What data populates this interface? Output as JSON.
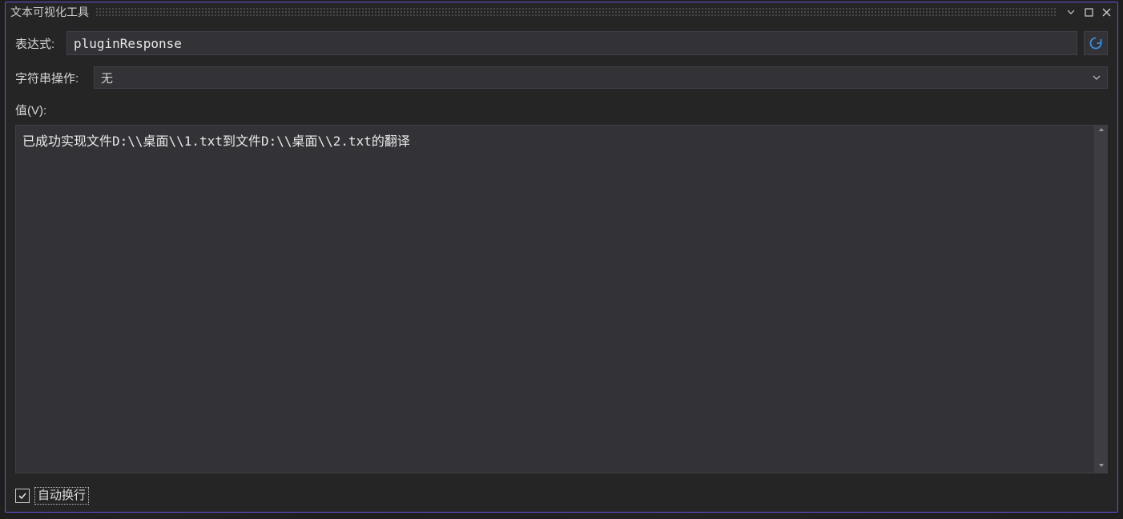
{
  "window": {
    "title": "文本可视化工具"
  },
  "form": {
    "expression_label": "表达式:",
    "expression_value": "pluginResponse",
    "string_ops_label": "字符串操作:",
    "string_ops_selected": "无",
    "value_label": "值(V):",
    "value_text": "已成功实现文件D:\\\\桌面\\\\1.txt到文件D:\\\\桌面\\\\2.txt的翻译"
  },
  "footer": {
    "wrap_checked": true,
    "wrap_label": "自动换行"
  }
}
